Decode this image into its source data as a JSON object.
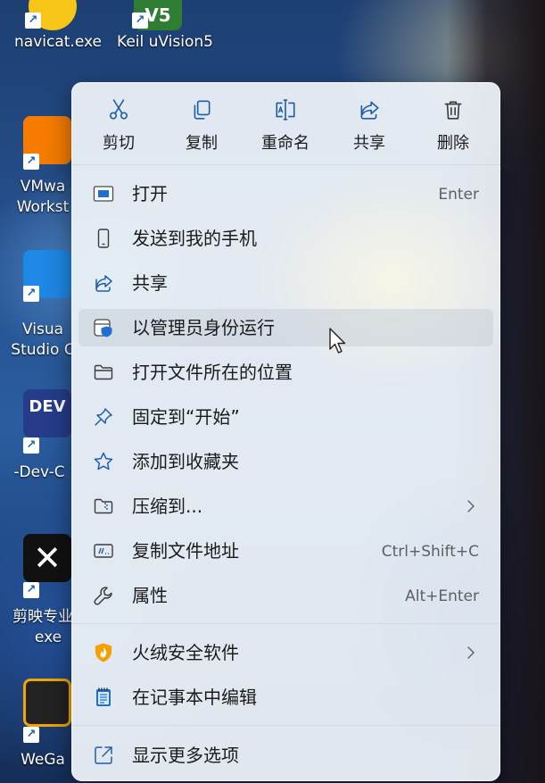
{
  "desktop": {
    "icons": [
      {
        "label": "navicat.exe",
        "icon": "navicat-icon",
        "color": "#f5c518"
      },
      {
        "label": "Keil uVision5",
        "icon": "keil-icon",
        "color": "#2e7d32",
        "badge": "V5"
      },
      {
        "label": "VMwa",
        "label2": "Workst",
        "icon": "vmware-icon",
        "color": "#f57c00"
      },
      {
        "label": "Visua",
        "label2": "Studio C",
        "icon": "vscode-icon",
        "color": "#1e88e5"
      },
      {
        "label": "-Dev-C",
        "icon": "devcpp-icon",
        "color": "#263c8a",
        "badge": "DEV"
      },
      {
        "label": "剪映专业",
        "label2": "exe",
        "icon": "jianying-icon",
        "color": "#111111"
      },
      {
        "label": "WeGa",
        "icon": "wegame-icon",
        "color": "#222222"
      }
    ]
  },
  "menu": {
    "toolbar": [
      {
        "label": "剪切",
        "icon": "scissors-icon"
      },
      {
        "label": "复制",
        "icon": "copy-icon"
      },
      {
        "label": "重命名",
        "icon": "rename-icon"
      },
      {
        "label": "共享",
        "icon": "share-icon"
      },
      {
        "label": "删除",
        "icon": "trash-icon"
      }
    ],
    "items": [
      {
        "label": "打开",
        "shortcut": "Enter",
        "icon": "open-app-icon"
      },
      {
        "label": "发送到我的手机",
        "shortcut": "",
        "icon": "phone-icon"
      },
      {
        "label": "共享",
        "shortcut": "",
        "icon": "share-icon"
      },
      {
        "label": "以管理员身份运行",
        "shortcut": "",
        "icon": "admin-shield-icon"
      },
      {
        "label": "打开文件所在的位置",
        "shortcut": "",
        "icon": "folder-icon"
      },
      {
        "label": "固定到“开始”",
        "shortcut": "",
        "icon": "pin-icon"
      },
      {
        "label": "添加到收藏夹",
        "shortcut": "",
        "icon": "star-icon"
      },
      {
        "label": "压缩到...",
        "shortcut": "",
        "icon": "zip-folder-icon"
      },
      {
        "label": "复制文件地址",
        "shortcut": "Ctrl+Shift+C",
        "icon": "copy-path-icon"
      },
      {
        "label": "属性",
        "shortcut": "Alt+Enter",
        "icon": "wrench-icon"
      },
      {
        "label": "火绒安全软件",
        "shortcut": "",
        "icon": "huorong-icon"
      },
      {
        "label": "在记事本中编辑",
        "shortcut": "",
        "icon": "notepad-icon"
      },
      {
        "label": "显示更多选项",
        "shortcut": "",
        "icon": "more-options-icon"
      }
    ],
    "accent": "#1f6fd1"
  }
}
